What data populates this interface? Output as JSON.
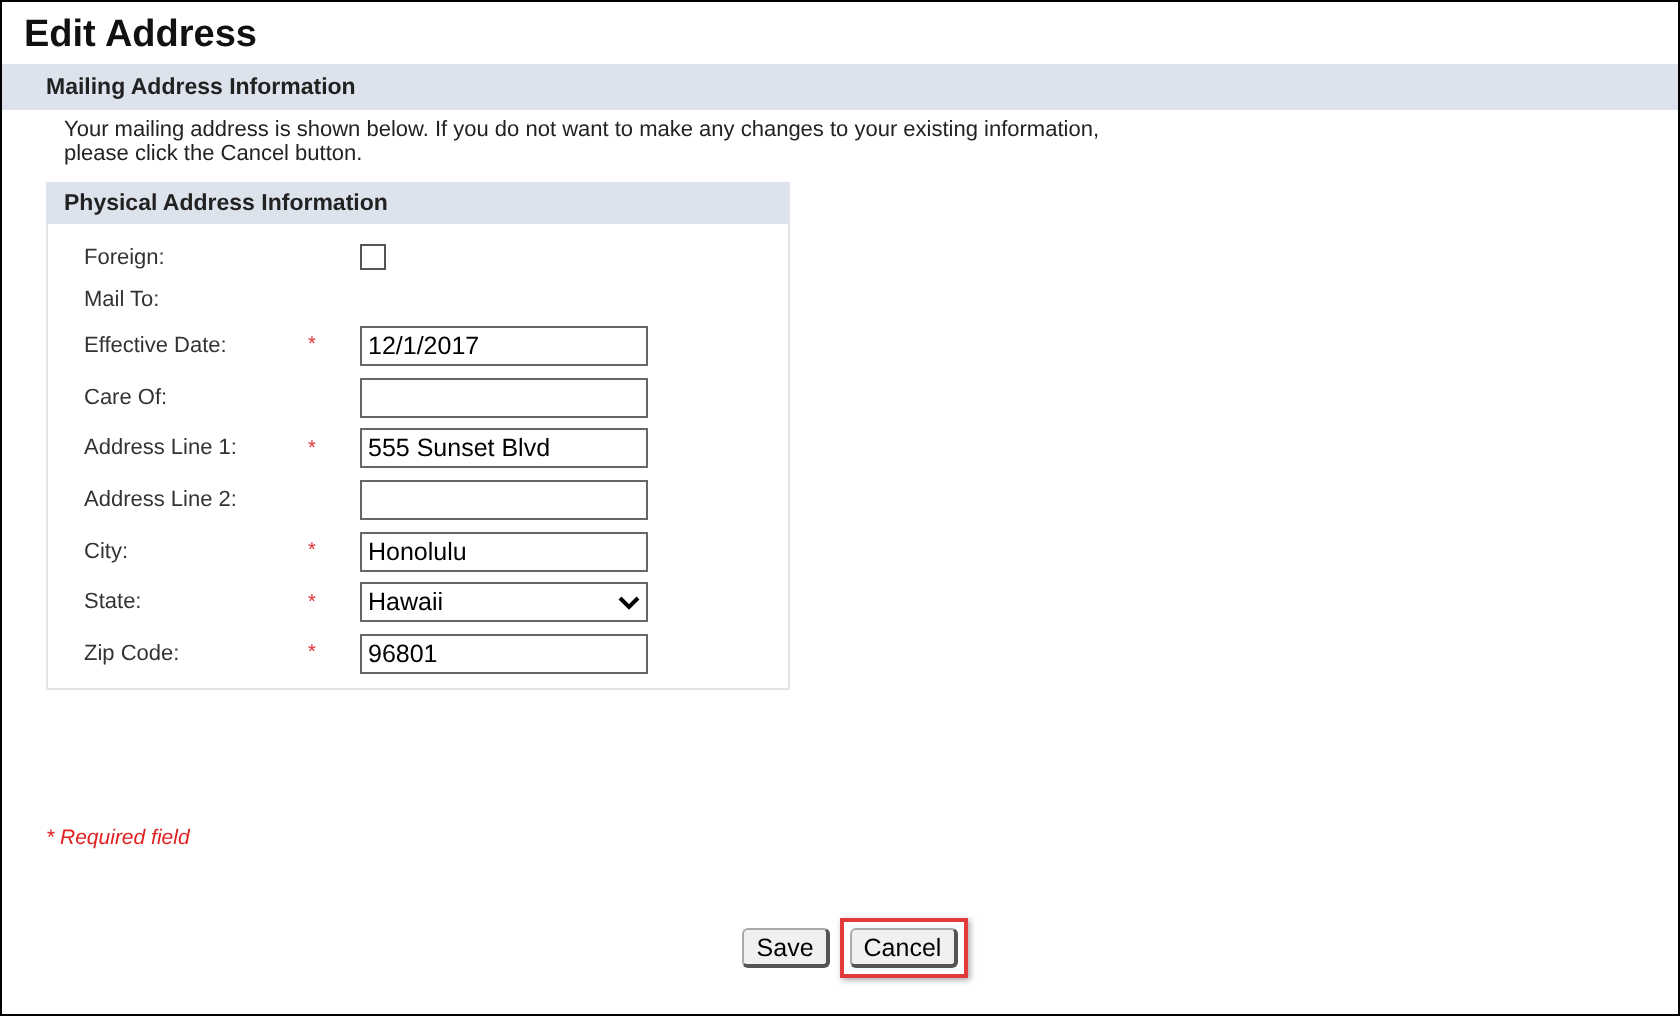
{
  "title": "Edit Address",
  "section": {
    "title": "Mailing Address Information",
    "intro": "Your mailing address is shown below. If you do not want to make any changes to your existing information,\nplease click the Cancel button."
  },
  "panel": {
    "title": "Physical Address Information",
    "fields": [
      {
        "kind": "checkbox",
        "label": "Foreign:",
        "required": false,
        "checked": false
      },
      {
        "kind": "label",
        "label": "Mail To:",
        "required": false
      },
      {
        "kind": "input",
        "label": "Effective Date:",
        "required": true,
        "value": "12/1/2017"
      },
      {
        "kind": "input",
        "label": "Care Of:",
        "required": false
      },
      {
        "kind": "input",
        "label": "Address Line 1:",
        "required": true,
        "value": "555 Sunset Blvd"
      },
      {
        "kind": "input",
        "label": "Address Line 2:",
        "required": false
      },
      {
        "kind": "input",
        "label": "City:",
        "required": true,
        "value": "Honolulu"
      },
      {
        "kind": "select",
        "label": "State:",
        "required": true,
        "value": "Hawaii"
      },
      {
        "kind": "input",
        "label": "Zip Code:",
        "required": true,
        "value": "96801"
      }
    ],
    "required_mark": "*"
  },
  "required_note": "* Required field",
  "buttons": [
    {
      "label": "Save",
      "highlighted": false
    },
    {
      "label": "Cancel",
      "highlighted": true
    }
  ]
}
